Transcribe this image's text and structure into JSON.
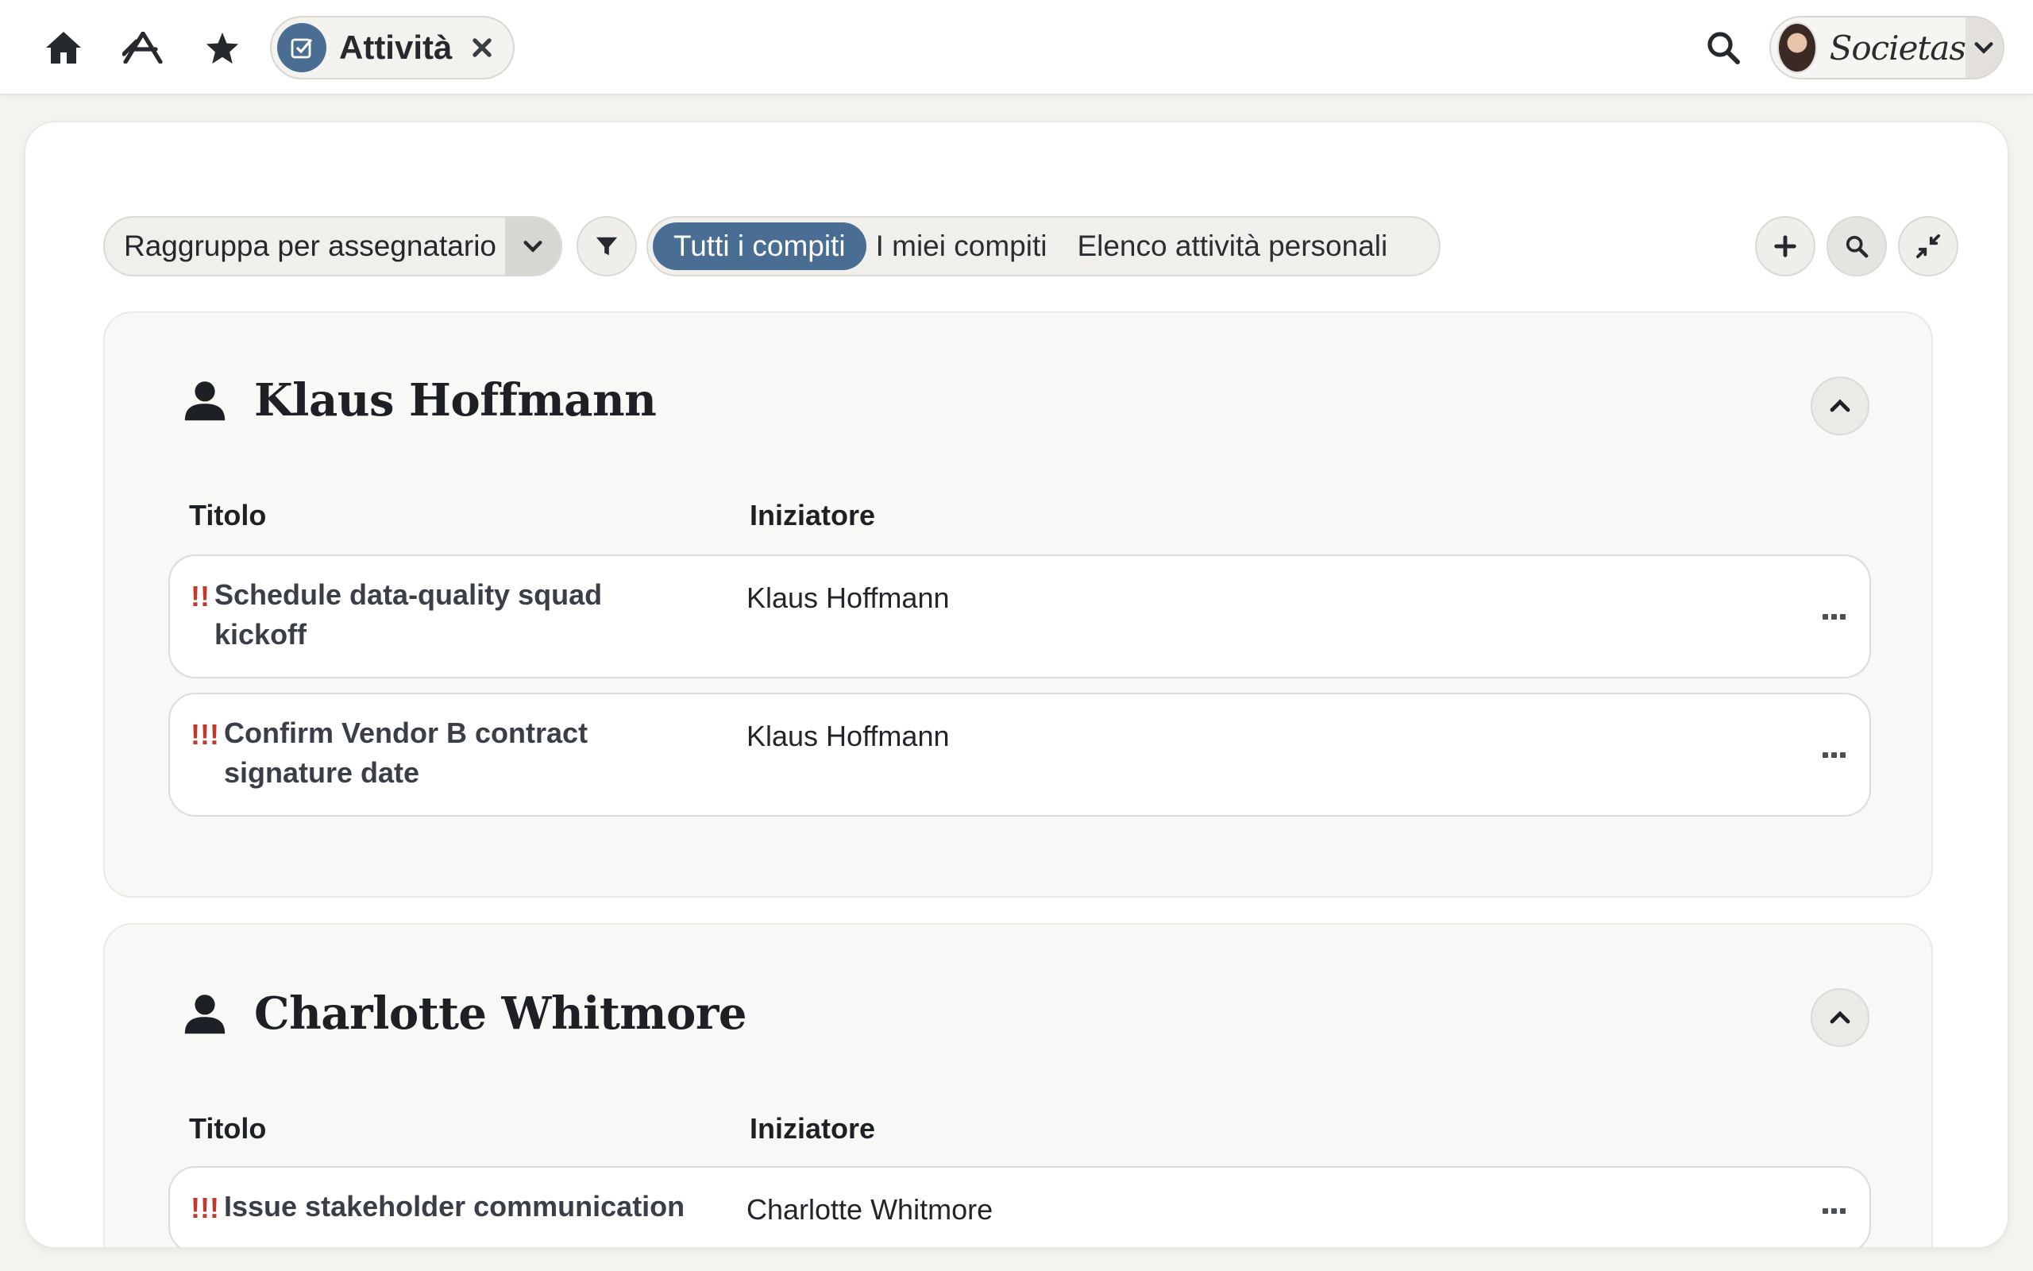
{
  "topbar": {
    "home_icon": "home-icon",
    "apps_icon": "apps-icon",
    "favorites_icon": "star-icon",
    "active_tab": {
      "label": "Attività",
      "icon": "task-check-icon",
      "close_icon": "close-icon"
    },
    "search_icon": "search-icon",
    "user": {
      "brand": "Societas",
      "avatar": "avatar",
      "menu_icon": "chevron-down-icon"
    }
  },
  "toolbar": {
    "group_by": {
      "label": "Raggruppa per assegnatario",
      "icon": "chevron-down-icon"
    },
    "filter_icon": "filter-icon",
    "views": [
      "Tutti i compiti",
      "I miei compiti",
      "Elenco attività personali"
    ],
    "active_view": "Tutti i compiti",
    "actions": [
      "plus-icon",
      "search-icon",
      "collapse-icon"
    ]
  },
  "groups": [
    {
      "name": "Klaus Hoffmann",
      "columns": {
        "title": "Titolo",
        "initiator": "Iniziatore"
      },
      "tasks": [
        {
          "priority": "!!",
          "title_line1": "Schedule data-quality squad",
          "title_line2": "kickoff",
          "initiator": "Klaus Hoffmann"
        },
        {
          "priority": "!!!",
          "title_line1": "Confirm Vendor B contract",
          "title_line2": "signature date",
          "initiator": "Klaus Hoffmann"
        }
      ]
    },
    {
      "name": "Charlotte Whitmore",
      "columns": {
        "title": "Titolo",
        "initiator": "Iniziatore"
      },
      "tasks": [
        {
          "priority": "!!!",
          "title_line1": "Issue stakeholder communication",
          "title_line2": "",
          "initiator": "Charlotte Whitmore"
        }
      ]
    }
  ],
  "colors": {
    "accent": "#4a6d94",
    "priority": "#c0392b",
    "background": "#f5f3f0"
  }
}
